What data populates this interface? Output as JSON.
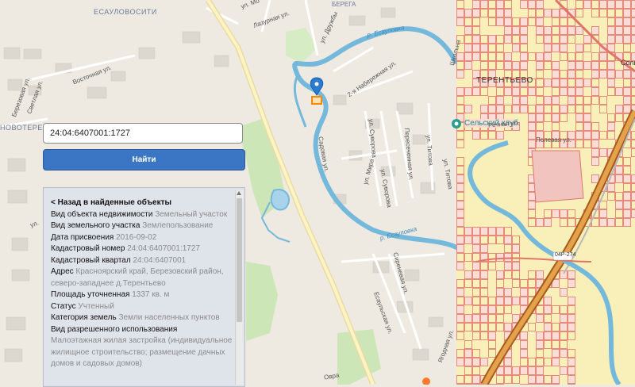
{
  "colors": {
    "accent": "#3a76c4",
    "river": "#74b9db",
    "park": "#cde6b8",
    "cadastre_fill": "#fbdcd6",
    "cadastre_line": "#e0756a",
    "yellow_zone": "#f8f0b8",
    "marker": "#2b7bd0",
    "parcel": "#ff8800"
  },
  "search": {
    "value": "24:04:6407001:1727"
  },
  "find_button": {
    "label": "Найти"
  },
  "map_labels": {
    "esaulovo": "ЕСАУЛОВОСИТИ",
    "novoterent": "НОВОТЕРЕНТ",
    "terentevo": "ТЕРЕНТЬЕВО",
    "berega": "БЕРЕГА",
    "club": "Сельский клуб",
    "sol": "Соль",
    "lazurnaya": "Лазурная ул.",
    "druzhby": "ул. Дружбы",
    "mo": "ул. Мо",
    "vostochnaya": "Восточная ул.",
    "berezovaya": "Березовая ул.",
    "svetlaya": "Светлая ул.",
    "river_top": "р. Есауловка",
    "river_bottom": "р. Есауловка",
    "naberezhnaya": "2-я Набережная ул.",
    "suvorova1": "ул. Суворова",
    "suvorova2": "ул. Суворова",
    "mira": "ул. Мира",
    "sadovaya": "Садовая ул.",
    "peresechennaya": "Пересеченная ул.",
    "titova1": "ул. Титова",
    "titova2": "ул. Титова",
    "shkolnaya": "Школьна",
    "sirenevaya": "Сиреневая ул.",
    "esaulskaya": "Есаульская ул.",
    "yagodnaya": "Ягодная ул.",
    "rechnaya": "Речная ул.",
    "polevaya": "Полевая ул.",
    "ul_left": "ул.",
    "road_badge": "04Р-274",
    "bottom_label": "Оврa"
  },
  "panel": {
    "back": "< Назад в найденные объекты",
    "rows": [
      {
        "key": "Вид объекта недвижимости",
        "value": "Земельный участок"
      },
      {
        "key": "Вид земельного участка",
        "value": "Землепользование"
      },
      {
        "key": "Дата присвоения",
        "value": "2016-09-02"
      },
      {
        "key": "Кадастровый номер",
        "value": "24:04:6407001:1727"
      },
      {
        "key": "Кадастровый квартал",
        "value": "24:04:6407001"
      },
      {
        "key": "Адрес",
        "value": "Красноярский край, Березовский район, северо-западнее д.Терентьево"
      },
      {
        "key": "Площадь уточненная",
        "value": "1337 кв. м"
      },
      {
        "key": "Статус",
        "value": "Учтенный"
      },
      {
        "key": "Категория земель",
        "value": "Земли населенных пунктов"
      },
      {
        "key": "Вид разрешенного использования",
        "value": ""
      }
    ],
    "extra_value": "Малоэтажная жилая застройка (индивидуальное жилищное строительство; размещение дачных домов и садовых домов)"
  }
}
